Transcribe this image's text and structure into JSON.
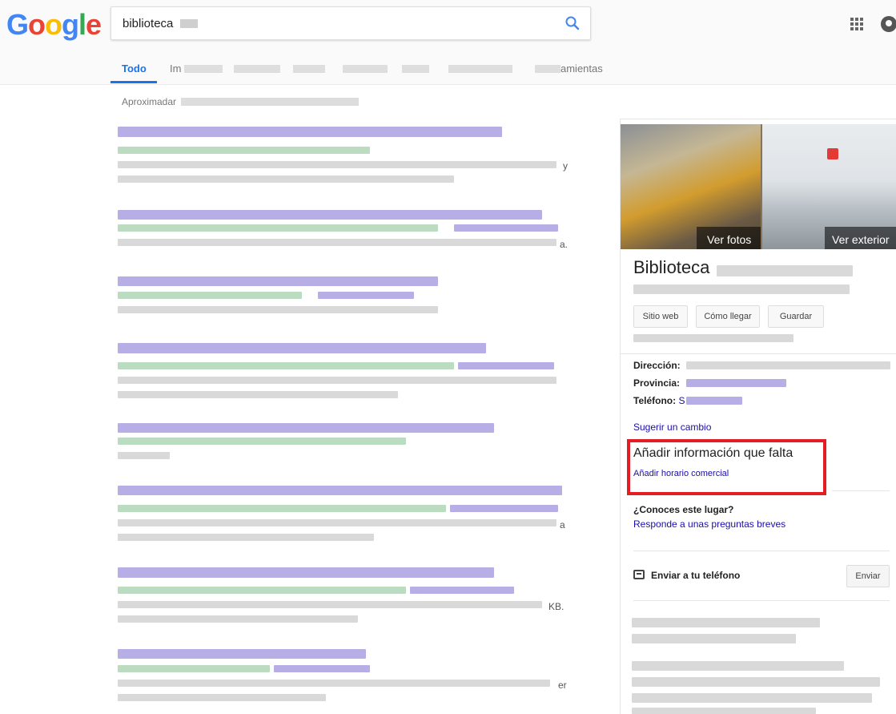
{
  "header": {
    "logo_letters": [
      {
        "ch": "G",
        "color": "#4285F4"
      },
      {
        "ch": "o",
        "color": "#EA4335"
      },
      {
        "ch": "o",
        "color": "#FBBC05"
      },
      {
        "ch": "g",
        "color": "#4285F4"
      },
      {
        "ch": "l",
        "color": "#34A853"
      },
      {
        "ch": "e",
        "color": "#EA4335"
      }
    ],
    "search_value": "biblioteca",
    "search_icon": "search-icon",
    "apps_icon": "apps-grid-icon",
    "account_icon": "account-icon"
  },
  "tabs": {
    "active": "Todo",
    "partial_images": "Im",
    "partial_tools": "amientas"
  },
  "results": {
    "stats_prefix": "Aproximadar",
    "tail_texts": [
      "y",
      "a.",
      "a",
      "KB.",
      "er"
    ]
  },
  "knowledge_panel": {
    "photo_left_label": "Ver fotos",
    "photo_right_label": "Ver exterior",
    "title": "Biblioteca",
    "actions": [
      "Sitio web",
      "Cómo llegar",
      "Guardar"
    ],
    "address_label": "Dirección:",
    "province_label": "Provincia:",
    "phone_label": "Teléfono:",
    "phone_value_partial": "S",
    "suggest_change": "Sugerir un cambio",
    "add_missing_title": "Añadir información que falta",
    "add_hours_link": "Añadir horario comercial",
    "know_question": "¿Conoces este lugar?",
    "know_answer_link": "Responde a unas preguntas breves",
    "send_to_phone": "Enviar a tu teléfono",
    "send_button": "Enviar",
    "highlight_color": "#e41c24"
  }
}
